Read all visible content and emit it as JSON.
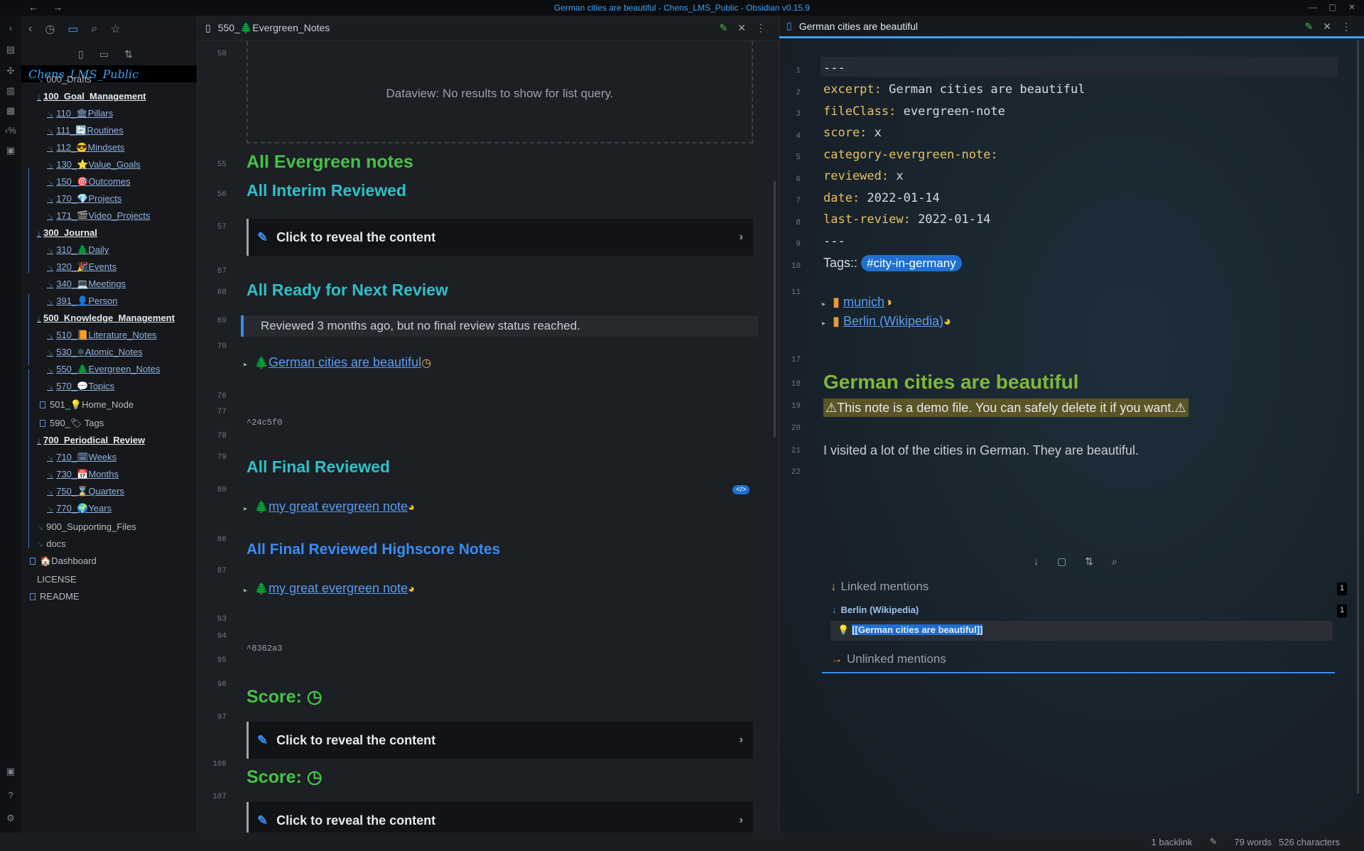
{
  "window": {
    "title": "German cities are beautiful - Chens_LMS_Public - Obsidian v0.15.9"
  },
  "sidebar": {
    "vault_name": "Chens_LMS_Public",
    "tree": [
      {
        "label": "000_Drafts",
        "kind": "folder"
      },
      {
        "label": "100_Goal_Management",
        "kind": "folder-open"
      },
      {
        "label": "110_🏛Pillars",
        "kind": "sub"
      },
      {
        "label": "111_🔄Routines",
        "kind": "sub"
      },
      {
        "label": "112_😎Mindsets",
        "kind": "sub"
      },
      {
        "label": "130_⭐Value_Goals",
        "kind": "sub"
      },
      {
        "label": "150_🎯Outcomes",
        "kind": "sub"
      },
      {
        "label": "170_💎Projects",
        "kind": "sub"
      },
      {
        "label": "171_🎬Video_Projects",
        "kind": "sub"
      },
      {
        "label": "300_Journal",
        "kind": "folder-open"
      },
      {
        "label": "310_🌲Daily",
        "kind": "sub"
      },
      {
        "label": "320_🎉Events",
        "kind": "sub"
      },
      {
        "label": "340_💻Meetings",
        "kind": "sub"
      },
      {
        "label": "391_👤Person",
        "kind": "sub"
      },
      {
        "label": "500_Knowledge_Management",
        "kind": "folder-open"
      },
      {
        "label": "510_📙Literature_Notes",
        "kind": "sub"
      },
      {
        "label": "530_⚛Atomic_Notes",
        "kind": "sub"
      },
      {
        "label": "550_🌲Evergreen_Notes",
        "kind": "sub"
      },
      {
        "label": "570_💬Topics",
        "kind": "sub"
      },
      {
        "label": "501_💡Home_Node",
        "kind": "file"
      },
      {
        "label": "590_🏷 Tags",
        "kind": "file"
      },
      {
        "label": "700_Periodical_Review",
        "kind": "folder-open"
      },
      {
        "label": "710_🗓Weeks",
        "kind": "sub"
      },
      {
        "label": "730_📅Months",
        "kind": "sub"
      },
      {
        "label": "750_⌛Quarters",
        "kind": "sub"
      },
      {
        "label": "770_🌍Years",
        "kind": "sub"
      },
      {
        "label": "900_Supporting_Files",
        "kind": "folder"
      },
      {
        "label": "docs",
        "kind": "folder"
      },
      {
        "label": "🏠Dashboard",
        "kind": "file"
      },
      {
        "label": "LICENSE",
        "kind": "plain"
      },
      {
        "label": "README",
        "kind": "file"
      }
    ]
  },
  "left_pane": {
    "tab_title": "550_🌲Evergreen_Notes",
    "line_numbers": [
      "50",
      "55",
      "56",
      "57",
      "67",
      "68",
      "69",
      "70",
      "76",
      "77",
      "78",
      "79",
      "80",
      "86",
      "87",
      "93",
      "94",
      "95",
      "96",
      "97",
      "106",
      "107"
    ],
    "dataview_empty": "Dataview: No results to show for list query.",
    "h_all_evergreen": "All Evergreen notes",
    "h_interim": "All Interim Reviewed",
    "reveal": "Click to reveal the content",
    "h_ready": "All Ready for Next Review",
    "quote": "Reviewed 3 months ago, but no final review status reached.",
    "link_german": "German cities are beautiful",
    "block_id_1": "^24c5f0",
    "h_final": "All Final Reviewed",
    "code_badge": "</>",
    "link_great": "my great evergreen note",
    "h_highscore": "All Final Reviewed Highscore Notes",
    "block_id_2": "^8362a3",
    "h_score": "Score:"
  },
  "right_pane": {
    "tab_title": "German cities are beautiful",
    "line_numbers": [
      "1",
      "2",
      "3",
      "4",
      "5",
      "6",
      "7",
      "8",
      "9",
      "10",
      "11",
      "17",
      "18",
      "19",
      "20",
      "21",
      "22"
    ],
    "frontmatter": [
      {
        "key": "---",
        "value": ""
      },
      {
        "key": "excerpt:",
        "value": " German cities are beautiful"
      },
      {
        "key": "fileClass:",
        "value": " evergreen-note"
      },
      {
        "key": "score:",
        "value": " x"
      },
      {
        "key": "category-evergreen-note:",
        "value": ""
      },
      {
        "key": "reviewed:",
        "value": " x"
      },
      {
        "key": "date:",
        "value": " 2022-01-14"
      },
      {
        "key": "last-review:",
        "value": " 2022-01-14"
      },
      {
        "key": "---",
        "value": ""
      }
    ],
    "tags_label": "Tags::",
    "tag": "#city-in-germany",
    "bullet_1": "munich",
    "bullet_2": "Berlin (Wikipedia)",
    "heading": "German cities are beautiful",
    "warning": "⚠This note is a demo file. You can safely delete it if you want.⚠",
    "body": "I visited a lot of the cities in German. They are beautiful.",
    "linked_mentions": "Linked mentions",
    "linked_count": "1",
    "mention_source": "Berlin (Wikipedia)",
    "mention_count": "1",
    "mention_text": "[[German cities are beautiful]]",
    "unlinked_mentions": "Unlinked mentions"
  },
  "status": {
    "backlinks": "1 backlink",
    "words": "79 words",
    "chars": "526 characters"
  },
  "colors": {
    "accent": "#3aa2f5",
    "h_green": "#45c346",
    "h_teal": "#2ec0c9",
    "h_yellowgreen": "#7fb83a"
  }
}
